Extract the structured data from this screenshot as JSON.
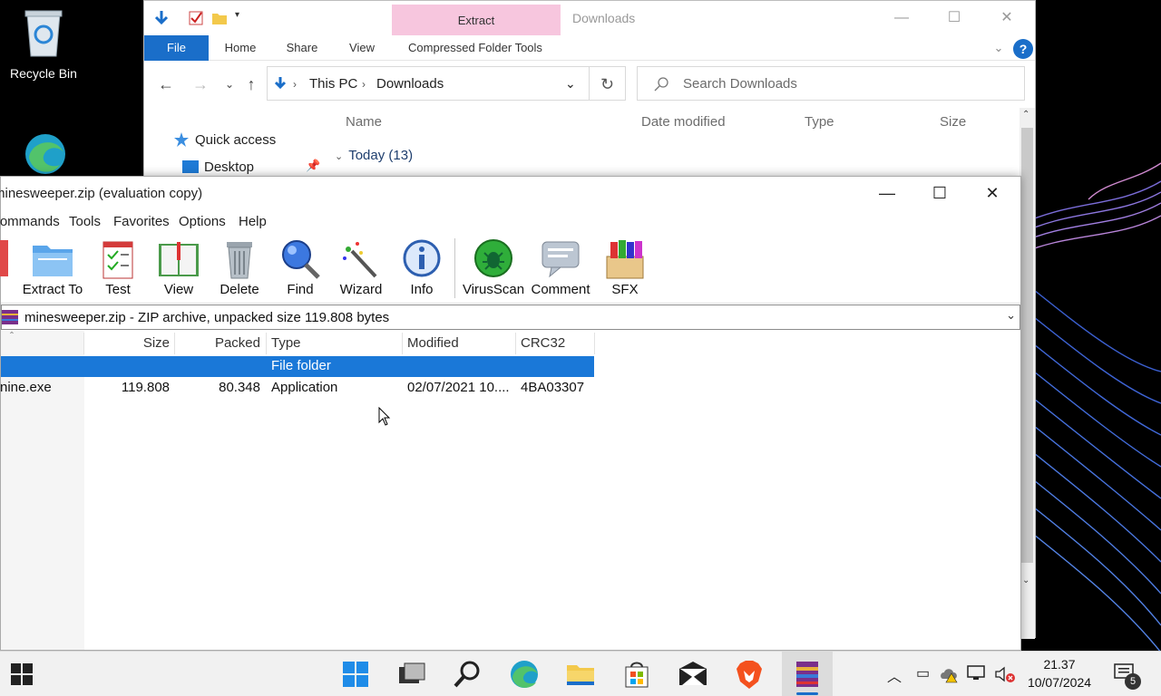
{
  "desktop": {
    "recycle_bin_label": "Recycle Bin"
  },
  "explorer": {
    "title": "Downloads",
    "contextual_tab": "Extract",
    "ribbon_tabs": [
      "File",
      "Home",
      "Share",
      "View",
      "Compressed Folder Tools"
    ],
    "breadcrumb": [
      "This PC",
      "Downloads"
    ],
    "search_placeholder": "Search Downloads",
    "nav": {
      "quick_access": "Quick access",
      "desktop": "Desktop"
    },
    "columns": [
      "Name",
      "Date modified",
      "Type",
      "Size"
    ],
    "group": "Today (13)"
  },
  "winrar": {
    "title": "minesweeper.zip (evaluation copy)",
    "menu": [
      "Commands",
      "Tools",
      "Favorites",
      "Options",
      "Help"
    ],
    "toolbar": [
      {
        "label": "Extract To",
        "icon": "extract-to-icon"
      },
      {
        "label": "Test",
        "icon": "test-icon"
      },
      {
        "label": "View",
        "icon": "view-icon"
      },
      {
        "label": "Delete",
        "icon": "delete-icon"
      },
      {
        "label": "Find",
        "icon": "find-icon"
      },
      {
        "label": "Wizard",
        "icon": "wizard-icon"
      },
      {
        "label": "Info",
        "icon": "info-icon"
      },
      {
        "label": "VirusScan",
        "icon": "virusscan-icon"
      },
      {
        "label": "Comment",
        "icon": "comment-icon"
      },
      {
        "label": "SFX",
        "icon": "sfx-icon"
      }
    ],
    "path_info": "minesweeper.zip - ZIP archive, unpacked size 119.808 bytes",
    "columns": [
      "Size",
      "Packed",
      "Type",
      "Modified",
      "CRC32"
    ],
    "rows": [
      {
        "name": "",
        "size": "",
        "packed": "",
        "type": "File folder",
        "modified": "",
        "crc": "",
        "selected": true
      },
      {
        "name": "nine.exe",
        "size": "119.808",
        "packed": "80.348",
        "type": "Application",
        "modified": "02/07/2021 10....",
        "crc": "4BA03307",
        "selected": false
      }
    ]
  },
  "taskbar": {
    "time": "21.37",
    "date": "10/07/2024",
    "notification_count": "5"
  },
  "colors": {
    "accent": "#1a6ec9",
    "selection": "#1a78d8",
    "extract_tab": "#f7c6de"
  }
}
